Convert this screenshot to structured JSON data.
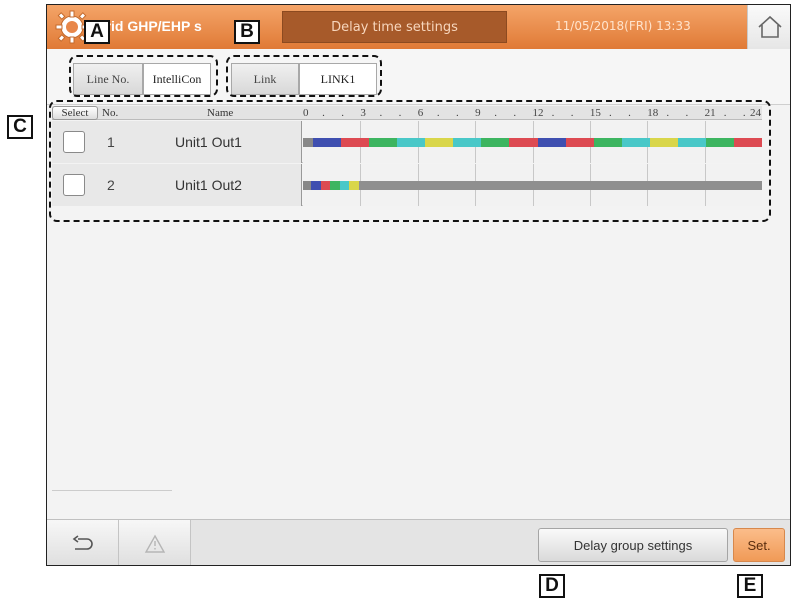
{
  "header": {
    "app_title": "brid GHP/EHP s",
    "title": "Delay time settings",
    "datetime": "11/05/2018(FRI) 13:33"
  },
  "selectors": {
    "line_label": "Line No.",
    "line_value": "IntelliCon",
    "link_label": "Link",
    "link_value": "LINK1"
  },
  "table": {
    "select_label": "Select",
    "no_header": "No.",
    "name_header": "Name",
    "ticks": [
      "0",
      ".",
      ".",
      "3",
      ".",
      ".",
      "6",
      ".",
      ".",
      "9",
      ".",
      ".",
      "12",
      ".",
      ".",
      "15",
      ".",
      ".",
      "18",
      ".",
      ".",
      "21",
      ".",
      ".",
      "24"
    ],
    "rows": [
      {
        "no": "1",
        "name": "Unit1 Out1",
        "checked": false,
        "segments": [
          "#888888",
          "#3f4fb0",
          "#dd4a52",
          "#3db560",
          "#49c8c8",
          "#d9d64a",
          "#49c8c8",
          "#3db560",
          "#dd4a52",
          "#3f4fb0",
          "#dd4a52",
          "#3db560",
          "#49c8c8",
          "#d9d64a",
          "#49c8c8",
          "#3db560",
          "#dd4a52"
        ]
      },
      {
        "no": "2",
        "name": "Unit1 Out2",
        "checked": false,
        "segments": [
          "#888888",
          "#3f4fb0",
          "#dd4a52",
          "#3db560",
          "#49c8c8",
          "#d9d64a",
          "#8f8f8f"
        ]
      }
    ]
  },
  "footer": {
    "delay_group_label": "Delay group settings",
    "set_label": "Set."
  },
  "callouts": {
    "a": "A",
    "b": "B",
    "c": "C",
    "d": "D",
    "e": "E"
  },
  "colors": {
    "header_orange": "#e8874a",
    "set_orange": "#f3a766"
  }
}
